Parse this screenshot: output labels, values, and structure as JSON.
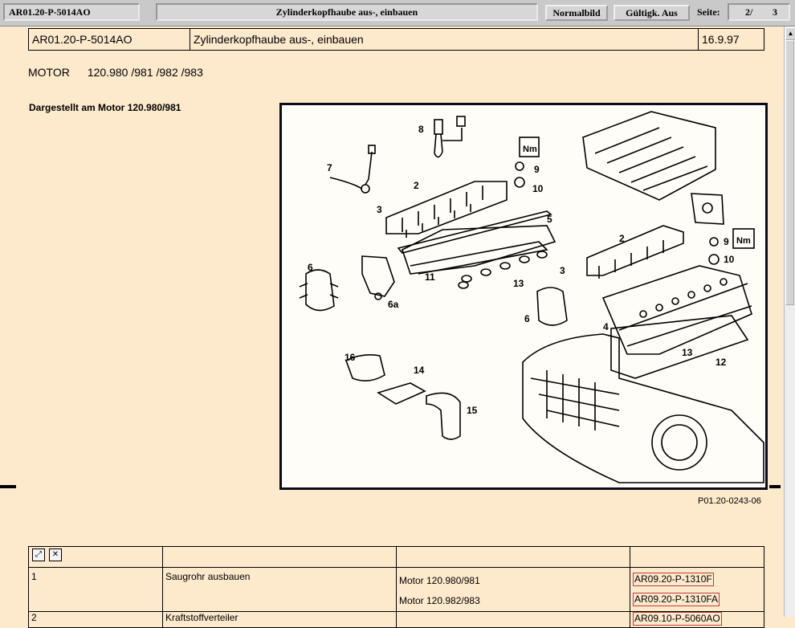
{
  "toolbar": {
    "doc_id": "AR01.20-P-5014AO",
    "title": "Zylinderkopfhaube aus-, einbauen",
    "normal_view_label": "Normalbild",
    "validity_label": "Gültigk. Aus",
    "page_label": "Seite:",
    "page_current": "2/",
    "page_total": "3"
  },
  "header": {
    "doc_id": "AR01.20-P-5014AO",
    "title": "Zylinderkopfhaube aus-, einbauen",
    "date": "16.9.97"
  },
  "motor": {
    "label": "MOTOR",
    "value": "120.980 /981 /982 /983"
  },
  "shown_on": "Dargestellt am Motor 120.980/981",
  "figure": {
    "code": "P01.20-0243-06",
    "callouts": [
      "8",
      "7",
      "2",
      "3",
      "5",
      "9",
      "10",
      "Nm",
      "6",
      "6a",
      "11",
      "13",
      "2",
      "9",
      "10",
      "Nm",
      "3",
      "6",
      "4",
      "13",
      "12",
      "16",
      "14",
      "15"
    ]
  },
  "steps": [
    {
      "num": "1",
      "action": "Saugrohr ausbauen",
      "variants": [
        {
          "motor": "Motor 120.980/981",
          "ref": "AR09.20-P-1310F"
        },
        {
          "motor": "Motor 120.982/983",
          "ref": "AR09.20-P-1310FA"
        }
      ]
    },
    {
      "num": "2",
      "action": "Kraftstoffverteiler",
      "motor": "",
      "ref": "AR09.10-P-5060AO"
    }
  ],
  "colors": {
    "background": "#fde9cc",
    "toolbar": "#c9c9c9",
    "ref_border": "#c23b3b"
  },
  "icons": [
    "expand-all-icon",
    "collapse-all-icon"
  ]
}
